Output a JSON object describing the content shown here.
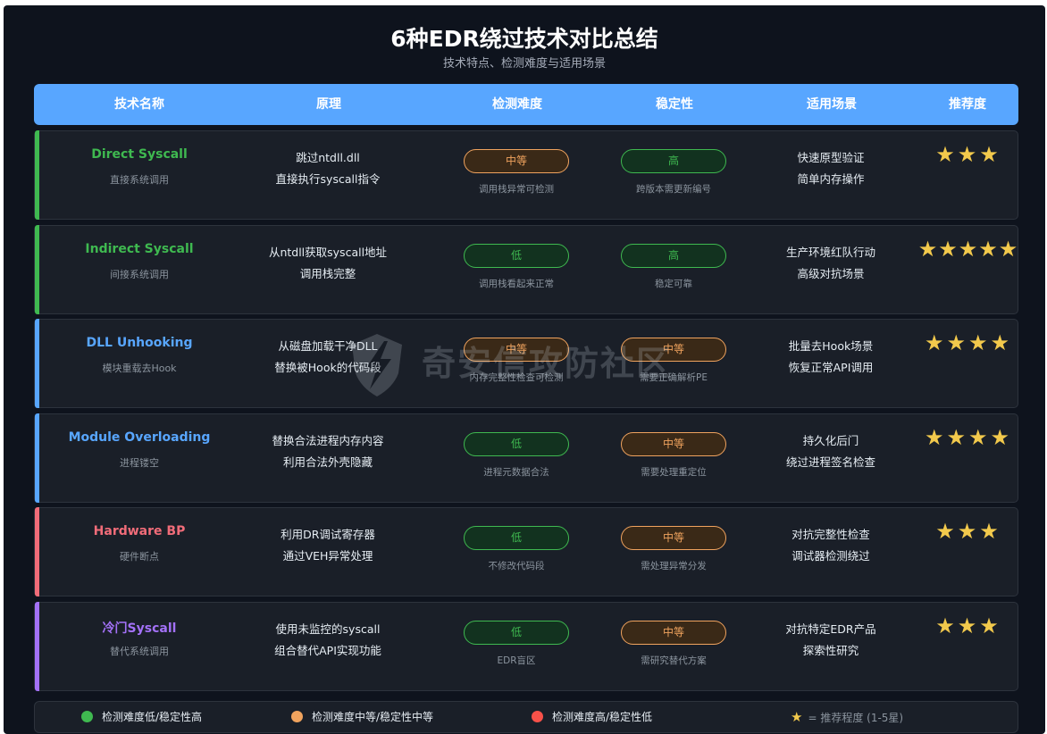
{
  "title": "6种EDR绕过技术对比总结",
  "subtitle": "技术特点、检测难度与适用场景",
  "columns": [
    "技术名称",
    "原理",
    "检测难度",
    "稳定性",
    "适用场景",
    "推荐度"
  ],
  "colors": {
    "accent_green": "#3fb950",
    "accent_blue": "#58a6ff",
    "accent_red": "#f16c79",
    "accent_purple": "#a371f7",
    "pill_orange": "#f0a35e",
    "star": "#f2c94c"
  },
  "rows": [
    {
      "name": "Direct Syscall",
      "name_sub": "直接系统调用",
      "principle": [
        "跳过ntdll.dll",
        "直接执行syscall指令"
      ],
      "detect": "中等",
      "detect_note": "调用栈异常可检测",
      "stability": "高",
      "stability_note": "跨版本需更新编号",
      "scenario": [
        "快速原型验证",
        "简单内存操作"
      ],
      "stars": "★★★",
      "rating": 3
    },
    {
      "name": "Indirect Syscall",
      "name_sub": "间接系统调用",
      "principle": [
        "从ntdll获取syscall地址",
        "调用栈完整"
      ],
      "detect": "低",
      "detect_note": "调用栈看起来正常",
      "stability": "高",
      "stability_note": "稳定可靠",
      "scenario": [
        "生产环境红队行动",
        "高级对抗场景"
      ],
      "stars": "★★★★★",
      "rating": 5
    },
    {
      "name": "DLL Unhooking",
      "name_sub": "模块重载去Hook",
      "principle": [
        "从磁盘加载干净DLL",
        "替换被Hook的代码段"
      ],
      "detect": "中等",
      "detect_note": "内存完整性检查可检测",
      "stability": "中等",
      "stability_note": "需要正确解析PE",
      "scenario": [
        "批量去Hook场景",
        "恢复正常API调用"
      ],
      "stars": "★★★★",
      "rating": 4
    },
    {
      "name": "Module Overloading",
      "name_sub": "进程镂空",
      "principle": [
        "替换合法进程内存内容",
        "利用合法外壳隐藏"
      ],
      "detect": "低",
      "detect_note": "进程元数据合法",
      "stability": "中等",
      "stability_note": "需要处理重定位",
      "scenario": [
        "持久化后门",
        "绕过进程签名检查"
      ],
      "stars": "★★★★",
      "rating": 4
    },
    {
      "name": "Hardware BP",
      "name_sub": "硬件断点",
      "principle": [
        "利用DR调试寄存器",
        "通过VEH异常处理"
      ],
      "detect": "低",
      "detect_note": "不修改代码段",
      "stability": "中等",
      "stability_note": "需处理异常分发",
      "scenario": [
        "对抗完整性检查",
        "调试器检测绕过"
      ],
      "stars": "★★★",
      "rating": 3
    },
    {
      "name": "冷门Syscall",
      "name_sub": "替代系统调用",
      "principle": [
        "使用未监控的syscall",
        "组合替代API实现功能"
      ],
      "detect": "低",
      "detect_note": "EDR盲区",
      "stability": "中等",
      "stability_note": "需研究替代方案",
      "scenario": [
        "对抗特定EDR产品",
        "探索性研究"
      ],
      "stars": "★★★",
      "rating": 3
    }
  ],
  "legend": {
    "low": "检测难度低/稳定性高",
    "mid": "检测难度中等/稳定性中等",
    "high": "检测难度高/稳定性低",
    "star_symbol": "★",
    "star_note": "= 推荐程度 (1-5星)"
  },
  "watermark": "奇安信攻防社区"
}
